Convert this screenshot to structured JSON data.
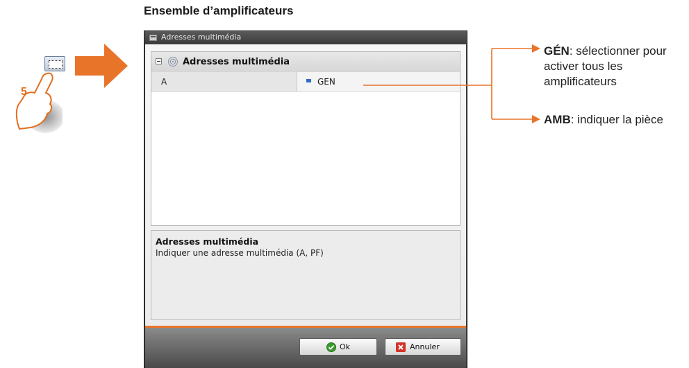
{
  "doc": {
    "heading": "Ensemble d’amplificateurs"
  },
  "illustration": {
    "step": "5"
  },
  "dialog": {
    "title": "Adresses multimédia",
    "group": {
      "label": "Adresses multimédia"
    },
    "property": {
      "name": "A",
      "value": "GEN"
    },
    "description": {
      "title": "Adresses multimédia",
      "text": "Indiquer une adresse multimédia (A, PF)"
    },
    "buttons": {
      "ok": "Ok",
      "cancel": "Annuler"
    }
  },
  "callouts": {
    "gen": {
      "key": "GÉN",
      "text": ": sélectionner pour activer tous les amplificateurs"
    },
    "amb": {
      "key": "AMB",
      "text": ": indiquer la pièce"
    }
  },
  "colors": {
    "accent": "#e8742a",
    "dialog_frame": "#3a3a3a"
  }
}
